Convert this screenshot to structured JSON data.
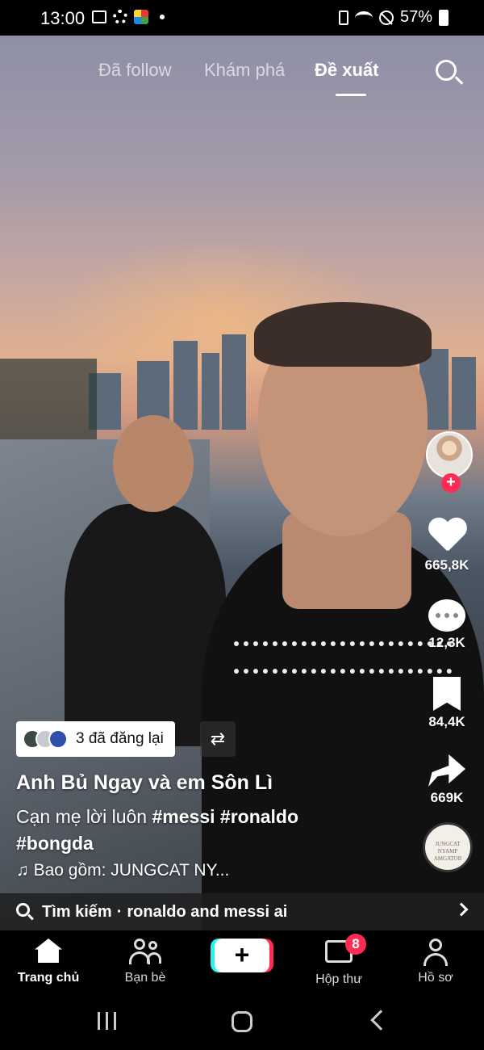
{
  "status_bar": {
    "time": "13:00",
    "battery": "57%"
  },
  "top_tabs": [
    {
      "label": "Đã follow",
      "active": false
    },
    {
      "label": "Khám phá",
      "active": false
    },
    {
      "label": "Đề xuất",
      "active": true
    }
  ],
  "actions": {
    "likes": "665,8K",
    "comments": "12,3K",
    "saves": "84,4K",
    "shares": "669K",
    "music_disc_text": "JUNGCAT NYAMP AMGATOII"
  },
  "repost": {
    "label": "3 đã đăng lại"
  },
  "post": {
    "username": "Anh Bủ Ngay và em Sôn Lì",
    "caption_text": "Cạn mẹ lời luôn",
    "hashtags": [
      "#messi",
      "#ronaldo",
      "#bongda"
    ],
    "music": "♫ Bao gồm: JUNGCAT NY..."
  },
  "search_suggestion": {
    "prefix": "Tìm kiếm",
    "separator": "·",
    "query": "ronaldo and messi ai"
  },
  "bottom_nav": {
    "items": [
      {
        "label": "Trang chủ",
        "icon": "home-icon",
        "active": true
      },
      {
        "label": "Bạn bè",
        "icon": "friends-icon",
        "active": false
      },
      {
        "label": "+",
        "icon": "plus-icon",
        "active": false
      },
      {
        "label": "Hộp thư",
        "icon": "inbox-icon",
        "active": false
      },
      {
        "label": "Hồ sơ",
        "icon": "profile-icon",
        "active": false
      }
    ],
    "inbox_badge": "8"
  },
  "colors": {
    "accent": "#fe2c55",
    "cyan": "#25f4ee"
  }
}
